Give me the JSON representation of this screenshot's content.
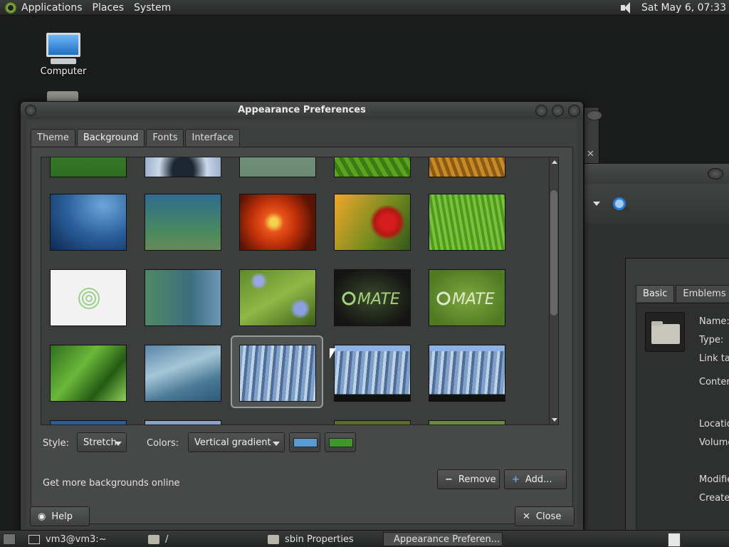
{
  "top_panel": {
    "menus": [
      "Applications",
      "Places",
      "System"
    ],
    "clock": "Sat May  6, 07:33"
  },
  "desktop": {
    "icons": [
      {
        "label": "Computer"
      }
    ]
  },
  "dialog": {
    "title": "Appearance Preferences",
    "tabs": [
      {
        "label": "Theme",
        "active": false
      },
      {
        "label": "Background",
        "active": true
      },
      {
        "label": "Fonts",
        "active": false
      },
      {
        "label": "Interface",
        "active": false
      }
    ],
    "style_label": "Style:",
    "style_value": "Stretch",
    "colors_label": "Colors:",
    "colors_value": "Vertical gradient",
    "primary_color": "#5b9bd5",
    "secondary_color": "#3d9a2a",
    "online_text": "Get more backgrounds online",
    "remove_label": "Remove",
    "add_label": "Add...",
    "help_label": "Help",
    "close_label": "Close"
  },
  "properties_window": {
    "tabs": [
      "Basic",
      "Emblems"
    ],
    "fields": [
      "Name:",
      "Type:",
      "Link tar",
      "Conten",
      "Location",
      "Volume",
      "Modifie",
      "Created"
    ]
  },
  "taskbar": {
    "items": [
      {
        "label": "vm3@vm3:~",
        "icon": "terminal-icon",
        "active": false
      },
      {
        "label": "/",
        "icon": "folder-icon",
        "active": false
      },
      {
        "label": "sbin Properties",
        "icon": "folder-icon",
        "active": false
      },
      {
        "label": "Appearance Preferen...",
        "icon": "appearance-icon",
        "active": true
      }
    ]
  }
}
